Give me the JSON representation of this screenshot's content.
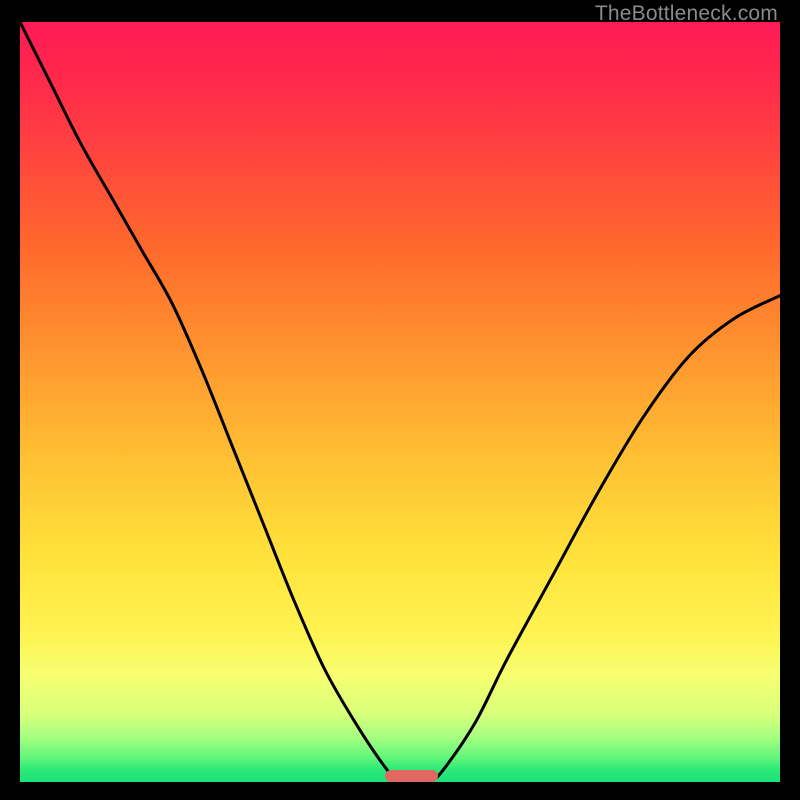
{
  "watermark": "TheBottleneck.com",
  "colors": {
    "curve_stroke": "#000000",
    "marker_fill": "#e06860",
    "background": "#000000"
  },
  "chart_data": {
    "type": "line",
    "title": "",
    "xlabel": "",
    "ylabel": "",
    "xlim": [
      0,
      100
    ],
    "ylim": [
      0,
      100
    ],
    "x": [
      0,
      4,
      8,
      12,
      16,
      20,
      24,
      28,
      32,
      36,
      40,
      44,
      48,
      50,
      52,
      54,
      56,
      60,
      64,
      70,
      76,
      82,
      88,
      94,
      100
    ],
    "y": [
      100,
      92,
      84,
      77,
      70,
      63,
      54,
      44,
      34,
      24,
      15,
      8,
      2,
      0,
      0,
      0,
      2,
      8,
      16,
      27,
      38,
      48,
      56,
      61,
      64
    ],
    "min_marker": {
      "x_start": 48,
      "x_end": 55,
      "y": 0,
      "height": 1.6
    },
    "gradient_stops": [
      {
        "pct": 0,
        "color": "#ff1a57"
      },
      {
        "pct": 8,
        "color": "#ff2a4a"
      },
      {
        "pct": 16,
        "color": "#ff4040"
      },
      {
        "pct": 30,
        "color": "#ff6a2c"
      },
      {
        "pct": 45,
        "color": "#ff9930"
      },
      {
        "pct": 58,
        "color": "#ffc233"
      },
      {
        "pct": 70,
        "color": "#ffe13a"
      },
      {
        "pct": 80,
        "color": "#fff250"
      },
      {
        "pct": 86,
        "color": "#f7ff70"
      },
      {
        "pct": 91,
        "color": "#d8ff7a"
      },
      {
        "pct": 94,
        "color": "#a8ff80"
      },
      {
        "pct": 97,
        "color": "#5cf57a"
      },
      {
        "pct": 98.5,
        "color": "#28e878"
      },
      {
        "pct": 100,
        "color": "#1ce278"
      }
    ]
  }
}
